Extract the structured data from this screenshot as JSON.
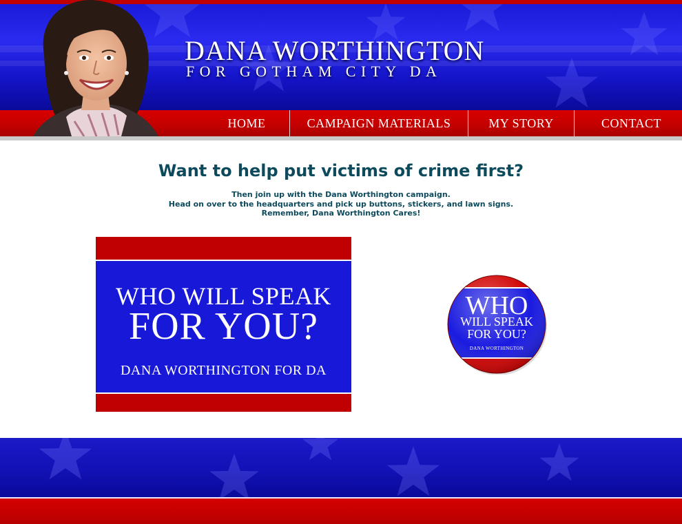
{
  "header": {
    "title": "DANA WORTHINGTON",
    "subtitle": "FOR GOTHAM CITY DA"
  },
  "nav": {
    "items": [
      {
        "label": "HOME"
      },
      {
        "label": "CAMPAIGN MATERIALS"
      },
      {
        "label": "MY STORY"
      },
      {
        "label": "CONTACT"
      }
    ]
  },
  "main": {
    "headline": "Want to help put victims of crime first?",
    "intro": [
      "Then join up with the Dana Worthington campaign.",
      "Head on over to the headquarters and pick up buttons, stickers, and lawn signs.",
      "Remember, Dana Worthington Cares!"
    ]
  },
  "lawn_sign": {
    "line1": "WHO WILL SPEAK",
    "line2": "FOR YOU?",
    "line3": "DANA WORTHINGTON FOR DA"
  },
  "campaign_button": {
    "line1": "WHO",
    "line2": "WILL SPEAK",
    "line3": "FOR YOU?",
    "line4": "DANA WORTHINGTON"
  },
  "colors": {
    "brand_red": "#c00000",
    "brand_blue": "#1818d8",
    "headline_teal": "#0d4a5c"
  },
  "icons": {
    "background_pattern": "star-icon"
  }
}
